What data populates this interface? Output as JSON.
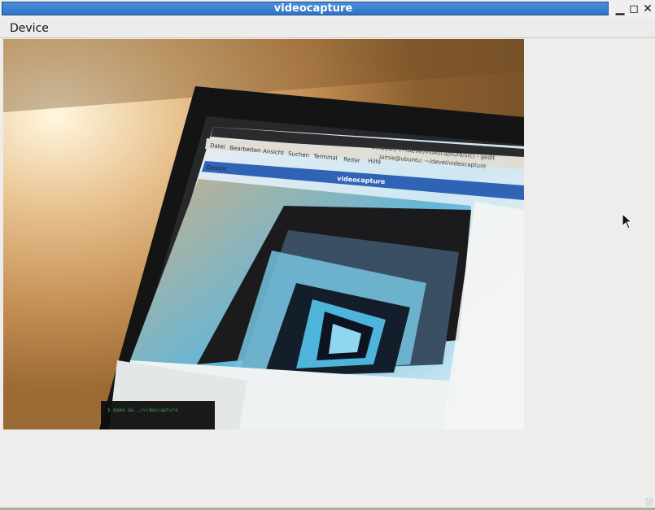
{
  "window": {
    "title": "videocapture"
  },
  "controls": {
    "minimize": "▁",
    "maximize": "◻",
    "close": "✕"
  },
  "menubar": {
    "items": [
      {
        "label": "Device"
      }
    ]
  },
  "video": {
    "nested_menu": [
      "Datei",
      "Bearbeiten",
      "Ansicht",
      "Suchen",
      "Terminal",
      "Reiter",
      "Hilfe"
    ],
    "nested_window_title": "window.c (~/devel/videocapture/src) - gedit",
    "nested_terminal_title": "jamie@ubuntu: ~/devel/videocapture",
    "nested_app_title": "videocapture",
    "nested_device_label": "Device"
  }
}
